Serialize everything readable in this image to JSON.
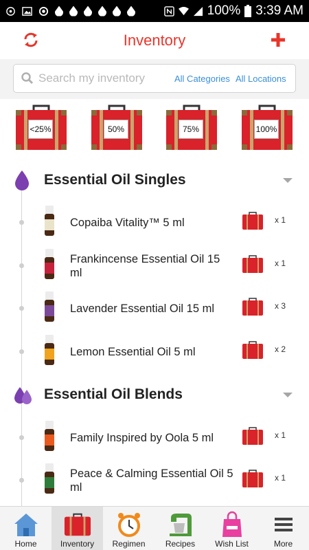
{
  "status_bar": {
    "battery": "100%",
    "time": "3:39 AM"
  },
  "header": {
    "title": "Inventory",
    "accent": "#e8352a"
  },
  "search": {
    "placeholder": "Search my inventory",
    "categories_label": "All Categories",
    "locations_label": "All Locations"
  },
  "level_filters": [
    {
      "label": "<25%"
    },
    {
      "label": "50%"
    },
    {
      "label": "75%"
    },
    {
      "label": "100%"
    }
  ],
  "sections": [
    {
      "title": "Essential Oil Singles",
      "icon": "single-drop-icon",
      "items": [
        {
          "name": "Copaiba Vitality™ 5 ml",
          "qty": "x 1",
          "bottle_color": "#e9e3c9"
        },
        {
          "name": "Frankincense Essential Oil 15 ml",
          "qty": "x 1",
          "bottle_color": "#c6223c"
        },
        {
          "name": "Lavender Essential Oil 15 ml",
          "qty": "x 3",
          "bottle_color": "#7d4a9a"
        },
        {
          "name": "Lemon Essential Oil 5 ml",
          "qty": "x 2",
          "bottle_color": "#f0a31e"
        }
      ]
    },
    {
      "title": "Essential Oil Blends",
      "icon": "double-drop-icon",
      "items": [
        {
          "name": "Family Inspired by Oola 5 ml",
          "qty": "x 1",
          "bottle_color": "#ea5a1f"
        },
        {
          "name": "Peace & Calming Essential Oil 5 ml",
          "qty": "x 1",
          "bottle_color": "#2f7d3a"
        }
      ]
    }
  ],
  "tabs": [
    {
      "label": "Home",
      "icon": "house-icon"
    },
    {
      "label": "Inventory",
      "icon": "suitcase-icon",
      "active": true
    },
    {
      "label": "Regimen",
      "icon": "alarm-clock-icon"
    },
    {
      "label": "Recipes",
      "icon": "mixer-icon"
    },
    {
      "label": "Wish List",
      "icon": "shopping-bag-icon"
    },
    {
      "label": "More",
      "icon": "menu-icon"
    }
  ]
}
